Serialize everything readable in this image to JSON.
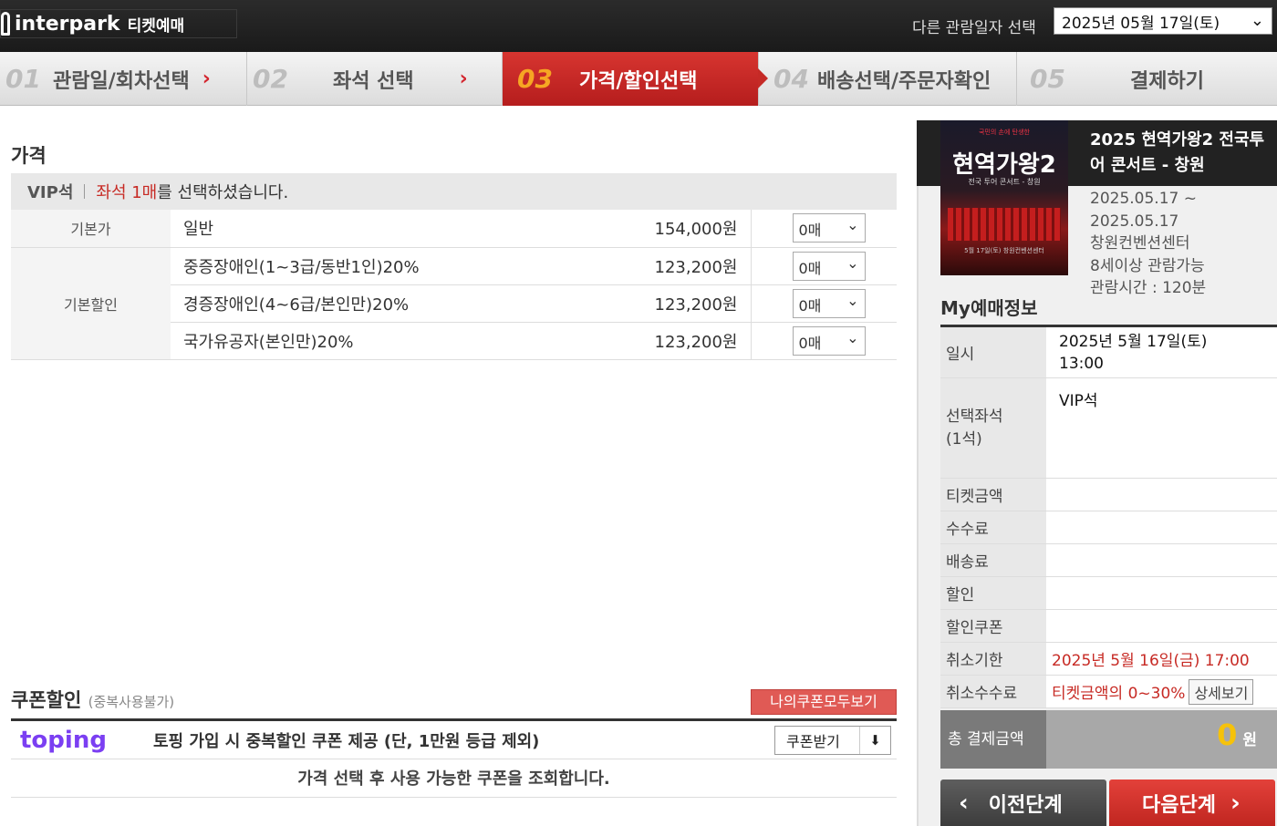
{
  "header": {
    "logo_text": "interpark",
    "logo_sub": "티켓예매",
    "date_label": "다른 관람일자 선택",
    "date_value": "2025년 05월 17일(토)"
  },
  "steps": [
    {
      "num": "01",
      "label": "관람일/회차선택"
    },
    {
      "num": "02",
      "label": "좌석 선택"
    },
    {
      "num": "03",
      "label": "가격/할인선택"
    },
    {
      "num": "04",
      "label": "배송선택/주문자확인"
    },
    {
      "num": "05",
      "label": "결제하기"
    }
  ],
  "price": {
    "title": "가격",
    "grade": "VIP석",
    "selected_red": "좌석 1매",
    "selected_text": "를 선택하셨습니다.",
    "base_label": "기본가",
    "discount_label": "기본할인",
    "rows": [
      {
        "name": "일반",
        "amount": "154,000원",
        "qty": "0매"
      },
      {
        "name": "중증장애인(1~3급/동반1인)20%",
        "amount": "123,200원",
        "qty": "0매"
      },
      {
        "name": "경증장애인(4~6급/본인만)20%",
        "amount": "123,200원",
        "qty": "0매"
      },
      {
        "name": "국가유공자(본인만)20%",
        "amount": "123,200원",
        "qty": "0매"
      }
    ]
  },
  "coupon": {
    "title": "쿠폰할인",
    "note": "(중복사용불가)",
    "my_coupons_btn": "나의쿠폰모두보기",
    "toping_logo": "toping",
    "toping_text": "토핑 가입 시 중복할인 쿠폰 제공 (단, 1만원 등급 제외)",
    "get_btn": "쿠폰받기",
    "info": "가격 선택 후 사용 가능한 쿠폰을 조회합니다."
  },
  "show": {
    "title": "2025 현역가왕2 전국투어 콘서트 - 창원",
    "period_start": "2025.05.17 ~",
    "period_end": "2025.05.17",
    "venue": "창원컨벤션센터",
    "age": "8세이상 관람가능",
    "runtime": "관람시간 : 120분",
    "poster_title": "현역가왕2",
    "poster_sub": "전국 투어 콘서트 - 창원",
    "poster_top": "국민의 손에 탄생한",
    "poster_date": "5월 17일(토) 창원컨벤션센터"
  },
  "my": {
    "title": "My예매정보",
    "date_key": "일시",
    "date_val1": "2025년 5월 17일(토)",
    "date_val2": "13:00",
    "seat_key1": "선택좌석",
    "seat_key2": "(1석)",
    "seat_val": "VIP석",
    "ticket_key": "티켓금액",
    "fee_key": "수수료",
    "delivery_key": "배송료",
    "discount_key": "할인",
    "coupon_key": "할인쿠폰",
    "cancel_key": "취소기한",
    "cancel_val": "2025년 5월 16일(금) 17:00",
    "cancel_fee_key": "취소수수료",
    "cancel_fee_val": "티켓금액의 0~30%",
    "detail_btn": "상세보기",
    "total_key": "총 결제금액",
    "total_val": "0",
    "total_unit": "원"
  },
  "nav": {
    "prev": "이전단계",
    "next": "다음단계"
  }
}
